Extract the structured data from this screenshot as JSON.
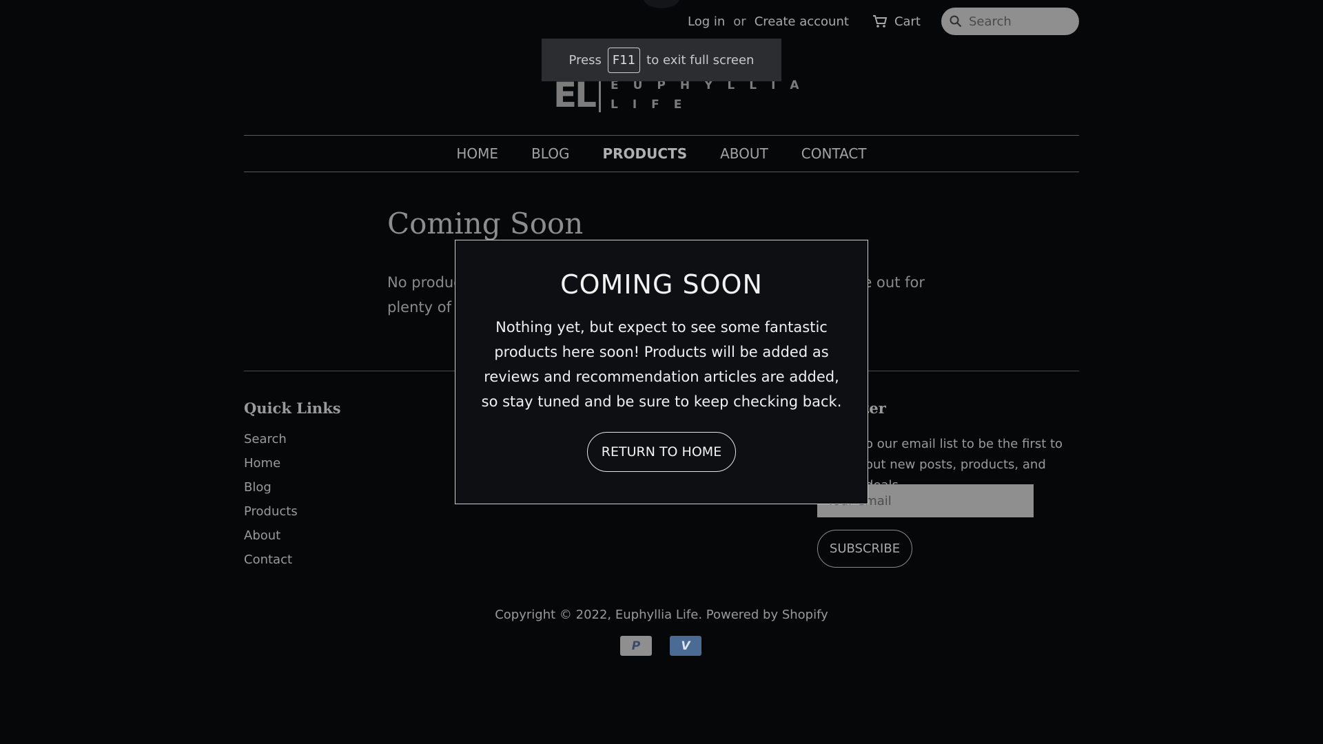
{
  "header": {
    "login": "Log in",
    "or": "or",
    "create_account": "Create account",
    "cart": "Cart",
    "search_placeholder": "Search"
  },
  "fullscreen_toast": {
    "press": "Press",
    "key": "F11",
    "message": "to exit full screen"
  },
  "logo": {
    "mark": "EL",
    "line1": "EUPHYLLIA",
    "line2": "LIFE"
  },
  "nav": {
    "items": [
      "HOME",
      "BLOG",
      "PRODUCTS",
      "ABOUT",
      "CONTACT"
    ],
    "active": "PRODUCTS"
  },
  "page": {
    "title": "Coming Soon",
    "body_line1": "No produc",
    "body_tail": "e out for",
    "body_line2": "plenty of f"
  },
  "footer": {
    "quick_links_heading": "Quick Links",
    "quick_links": [
      "Search",
      "Home",
      "Blog",
      "Products",
      "About",
      "Contact"
    ],
    "newsletter_heading_partial": "tter",
    "newsletter_line1": "o our email list to be the first to",
    "newsletter_line2": "out new posts, products, and deals.",
    "email_placeholder": "Your email",
    "subscribe": "SUBSCRIBE",
    "copyright": "Copyright © 2022, Euphyllia Life. Powered by Shopify",
    "payment_icons": [
      "paypal-icon",
      "venmo-icon"
    ]
  },
  "modal": {
    "title": "COMING SOON",
    "text": "Nothing yet, but expect to see some fantastic products here soon! Products will be added as reviews and recommendation articles are added, so stay tuned and be sure to keep checking back.",
    "button": "RETURN TO HOME"
  }
}
